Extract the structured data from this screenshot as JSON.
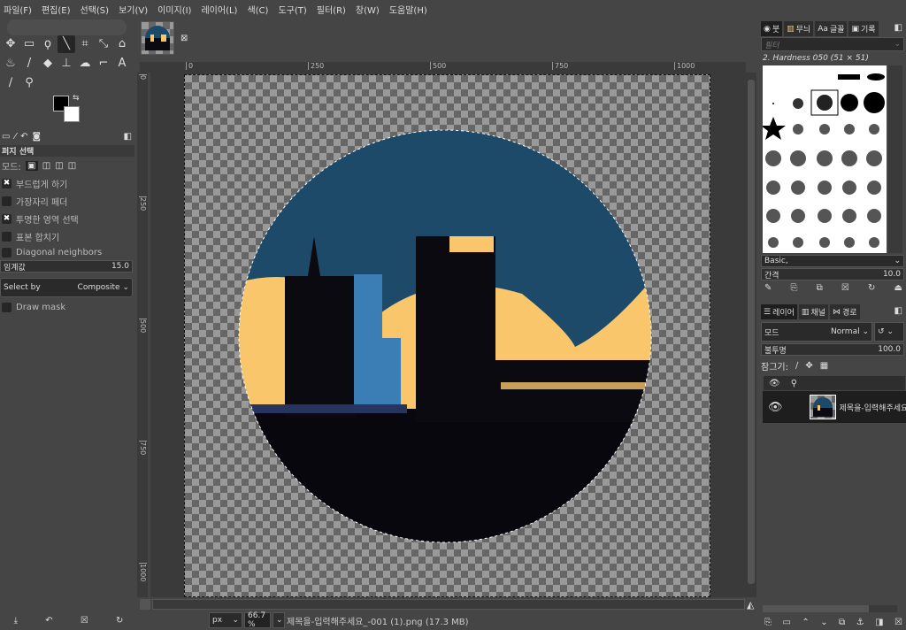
{
  "menu": [
    "파일(F)",
    "편집(E)",
    "선택(S)",
    "보기(V)",
    "이미지(I)",
    "레이어(L)",
    "색(C)",
    "도구(T)",
    "필터(R)",
    "창(W)",
    "도움말(H)"
  ],
  "tools": [
    {
      "name": "move-tool",
      "glyph": "✥"
    },
    {
      "name": "rect-select-tool",
      "glyph": "▭"
    },
    {
      "name": "lasso-tool",
      "glyph": "ϙ"
    },
    {
      "name": "fuzzy-select-tool",
      "glyph": "╲",
      "active": true
    },
    {
      "name": "crop-tool",
      "glyph": "⌗"
    },
    {
      "name": "transform-tool",
      "glyph": "⤡"
    },
    {
      "name": "warp-tool",
      "glyph": "⌂"
    },
    {
      "name": "bucket-fill-tool",
      "glyph": "♨"
    },
    {
      "name": "paintbrush-tool",
      "glyph": "/"
    },
    {
      "name": "eraser-tool",
      "glyph": "◆"
    },
    {
      "name": "clone-tool",
      "glyph": "⊥"
    },
    {
      "name": "smudge-tool",
      "glyph": "☁"
    },
    {
      "name": "paths-tool",
      "glyph": "⌐"
    },
    {
      "name": "text-tool",
      "glyph": "A"
    },
    {
      "name": "color-picker-tool",
      "glyph": "∕"
    },
    {
      "name": "zoom-tool",
      "glyph": "⚲"
    }
  ],
  "colors": {
    "foreground": "#000000",
    "background": "#ffffff",
    "accent": "#f9c66b",
    "sky": "#1e4a6a"
  },
  "tool_options": {
    "title": "퍼지 선택",
    "mode_label": "모드:",
    "options": [
      {
        "label": "부드럽게 하기",
        "checked": true
      },
      {
        "label": "가장자리 페더",
        "checked": false
      },
      {
        "label": "투명한 영역 선택",
        "checked": true
      },
      {
        "label": "표본 합치기",
        "checked": false
      },
      {
        "label": "Diagonal neighbors",
        "checked": false
      }
    ],
    "threshold_label": "임계값",
    "threshold_value": "15.0",
    "select_by_label": "Select by",
    "select_by_value": "Composite",
    "draw_mask_label": "Draw mask"
  },
  "image_tab": {
    "thumbnail": "city-circle"
  },
  "rulers": {
    "h": [
      "0",
      "250",
      "500",
      "750",
      "1000"
    ],
    "v": [
      "0",
      "250",
      "500",
      "750",
      "1000"
    ]
  },
  "status": {
    "unit": "px",
    "zoom": "66.7 %",
    "file": "제목을-입력해주세요_-001 (1).png (17.3 MB)"
  },
  "brushes": {
    "tabs": [
      "붓",
      "무늬",
      "글꼴",
      "기록"
    ],
    "filter_placeholder": "필터",
    "current": "2. Hardness 050 (51 × 51)",
    "preset": "Basic,",
    "spacing_label": "간격",
    "spacing_value": "10.0"
  },
  "layers": {
    "tabs": [
      "레이어",
      "채널",
      "경로"
    ],
    "mode_label": "모드",
    "mode_value": "Normal",
    "opacity_label": "불투명",
    "opacity_value": "100.0",
    "lock_label": "잠그기:",
    "items": [
      {
        "name": "제목을-입력해주세요",
        "visible": true
      }
    ]
  }
}
